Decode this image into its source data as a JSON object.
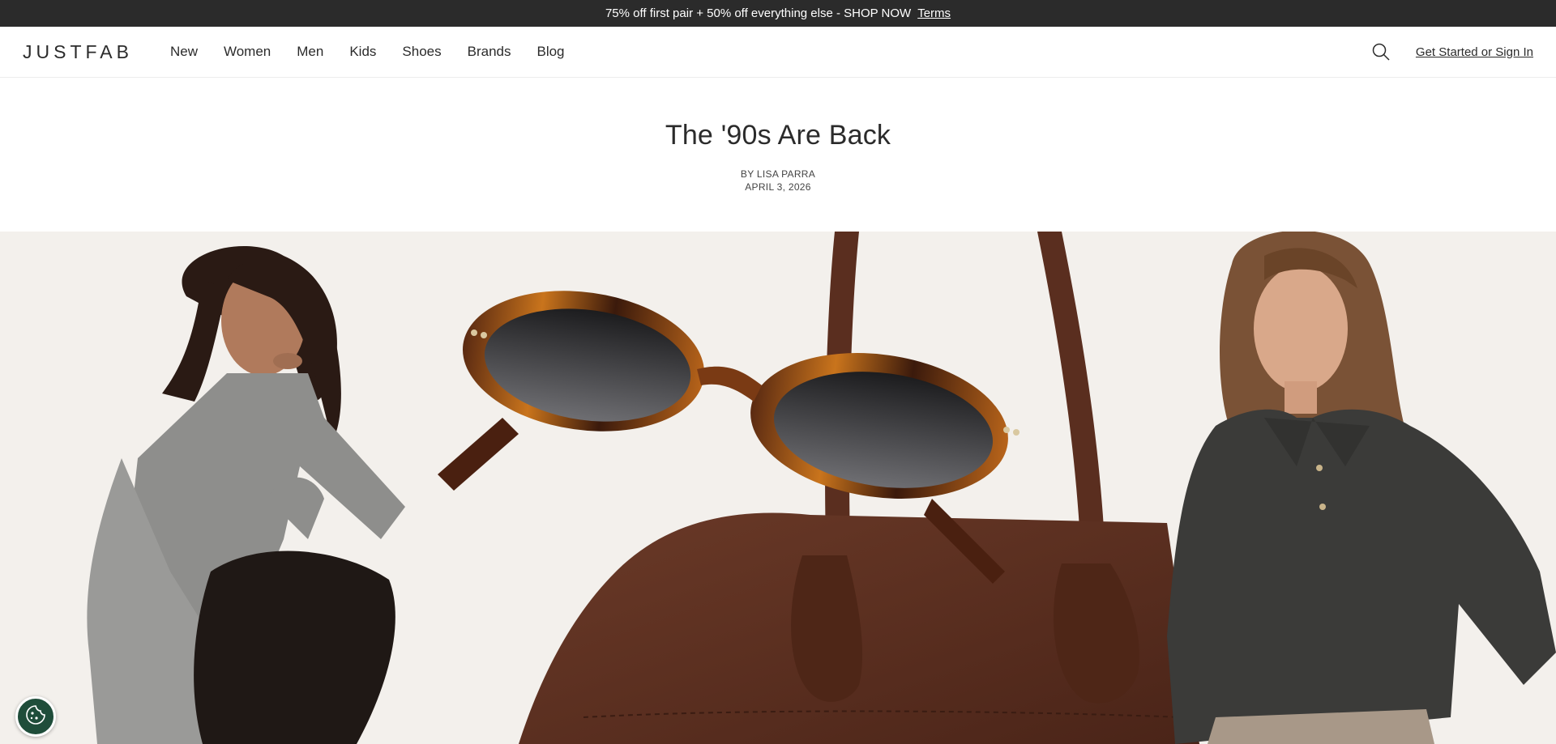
{
  "promo": {
    "text": "75% off first pair + 50% off everything else - SHOP NOW",
    "terms_label": "Terms"
  },
  "header": {
    "logo": "JUSTFAB",
    "nav": [
      "New",
      "Women",
      "Men",
      "Kids",
      "Shoes",
      "Brands",
      "Blog"
    ],
    "signin_label": "Get Started or Sign In",
    "icons": [
      "search-icon"
    ]
  },
  "article": {
    "title": "The '90s Are Back",
    "byline": "BY LISA PARRA",
    "date": "APRIL 3, 2026"
  },
  "hero": {
    "background": "#f3f0ec",
    "items": [
      "woman in grey knit dress",
      "tortoiseshell oval sunglasses",
      "brown leather handbag",
      "woman in charcoal polo sweater"
    ]
  },
  "cookie": {
    "icon": "cookie-icon",
    "color": "#1f4d3a"
  }
}
